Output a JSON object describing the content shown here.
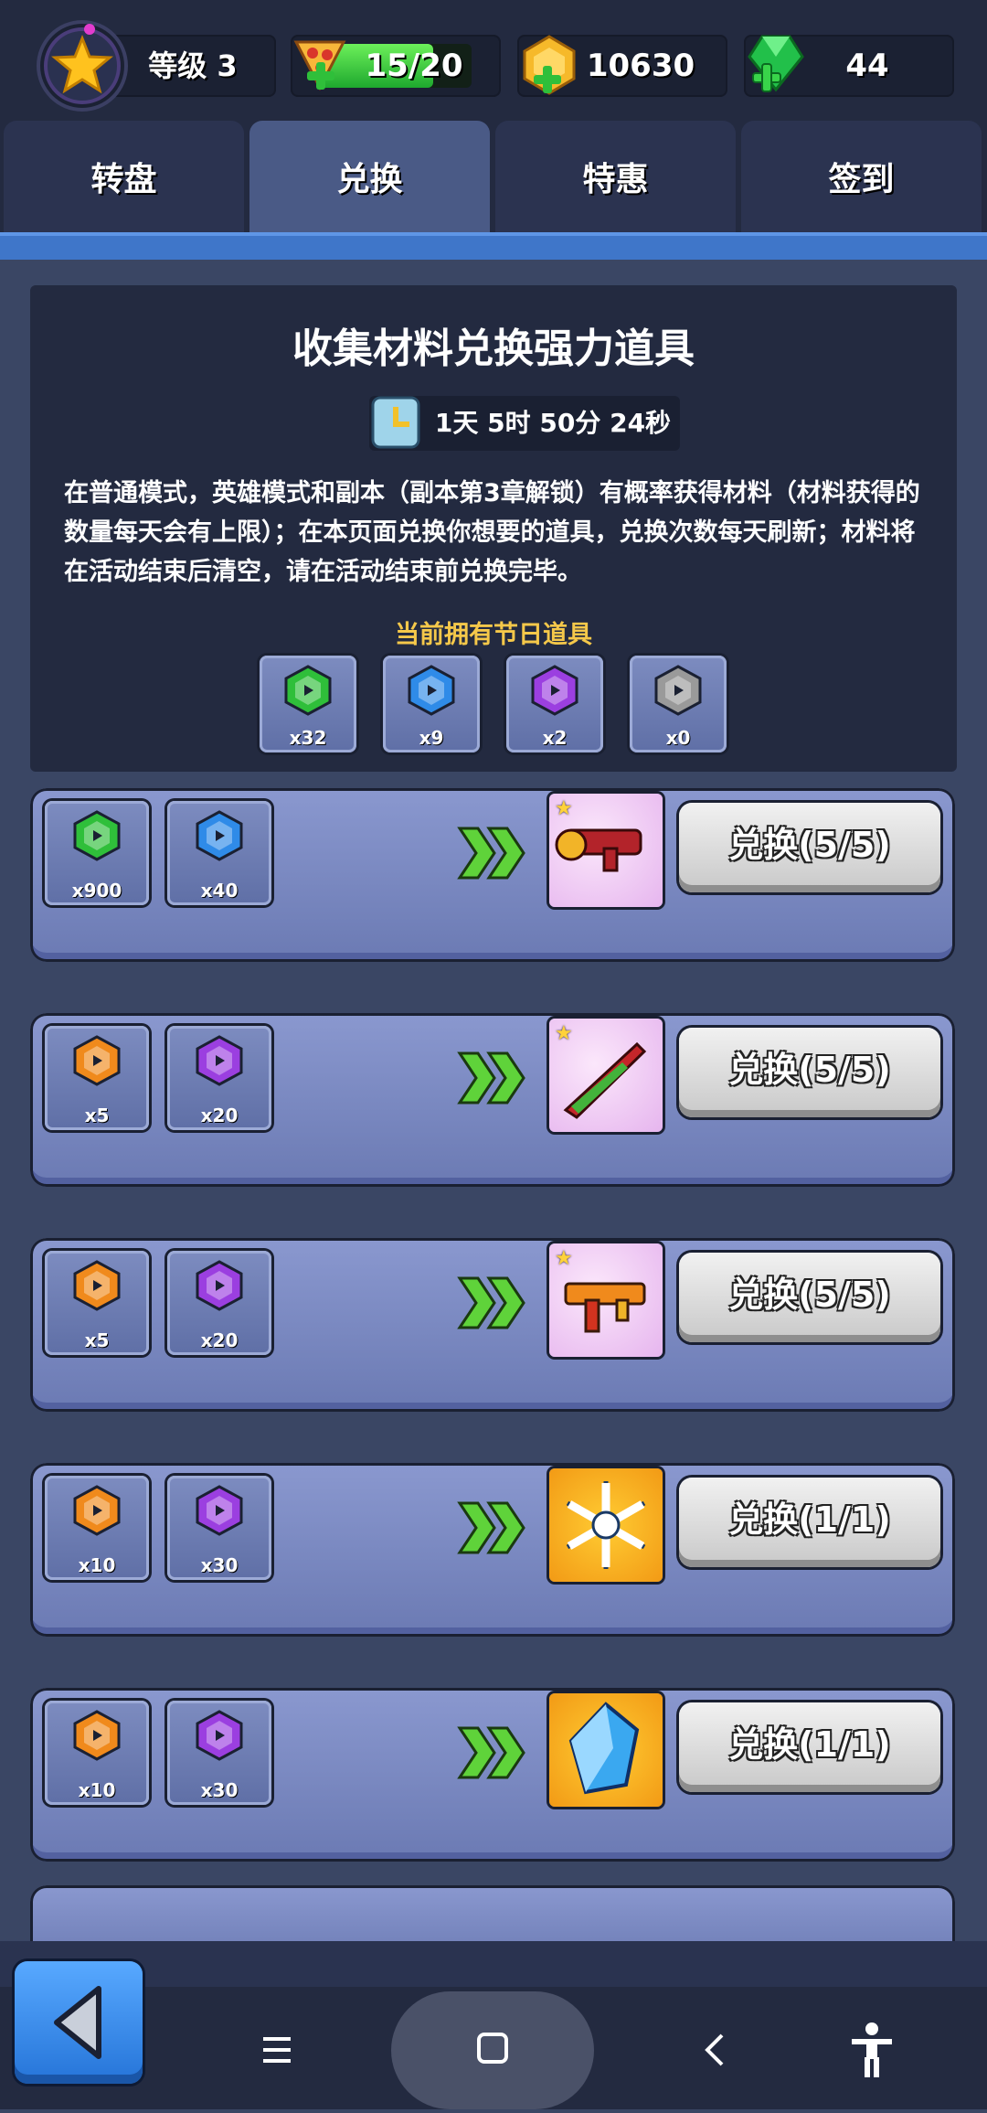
{
  "header": {
    "level_label": "等级 3",
    "stamina_value": "15/20",
    "stamina_fill": 0.75,
    "coins_value": "10630",
    "gems_value": "44"
  },
  "tabs": [
    {
      "label": "转盘",
      "active": false
    },
    {
      "label": "兑换",
      "active": true
    },
    {
      "label": "特惠",
      "active": false
    },
    {
      "label": "签到",
      "active": false
    }
  ],
  "panel": {
    "title": "收集材料兑换强力道具",
    "timer": "1天 5时 50分 24秒",
    "description": "在普通模式，英雄模式和副本（副本第3章解锁）有概率获得材料（材料获得的数量每天会有上限）；在本页面兑换你想要的道具，兑换次数每天刷新；材料将在活动结束后清空，请在活动结束前兑换完毕。",
    "owned_title": "当前拥有节日道具",
    "owned": [
      {
        "color": "#2fbf3a",
        "count": "x32"
      },
      {
        "color": "#2f8be8",
        "count": "x9"
      },
      {
        "color": "#9b3fe0",
        "count": "x2"
      },
      {
        "color": "#9a9a9a",
        "count": "x0"
      }
    ]
  },
  "exchanges": [
    {
      "mats": [
        {
          "color": "#2fbf3a",
          "count": "x900"
        },
        {
          "color": "#2f8be8",
          "count": "x40"
        }
      ],
      "reward": "rocket-launcher",
      "frame": "pink",
      "button": "兑换(5/5)"
    },
    {
      "mats": [
        {
          "color": "#f08a1c",
          "count": "x5"
        },
        {
          "color": "#9b3fe0",
          "count": "x20"
        }
      ],
      "reward": "red-blade",
      "frame": "pink",
      "button": "兑换(5/5)"
    },
    {
      "mats": [
        {
          "color": "#f08a1c",
          "count": "x5"
        },
        {
          "color": "#9b3fe0",
          "count": "x20"
        }
      ],
      "reward": "orange-rifle",
      "frame": "pink",
      "button": "兑换(5/5)"
    },
    {
      "mats": [
        {
          "color": "#f08a1c",
          "count": "x10"
        },
        {
          "color": "#9b3fe0",
          "count": "x30"
        }
      ],
      "reward": "snowflake",
      "frame": "gold",
      "button": "兑换(1/1)"
    },
    {
      "mats": [
        {
          "color": "#f08a1c",
          "count": "x10"
        },
        {
          "color": "#9b3fe0",
          "count": "x30"
        }
      ],
      "reward": "blue-crystal",
      "frame": "gold",
      "button": "兑换(1/1)"
    }
  ],
  "icons": [
    "star-icon",
    "pizza-icon",
    "coin-icon",
    "gem-icon",
    "clock-icon",
    "double-arrow-icon",
    "back-arrow-icon",
    "menu-icon",
    "home-icon",
    "nav-back-icon",
    "accessibility-icon"
  ]
}
